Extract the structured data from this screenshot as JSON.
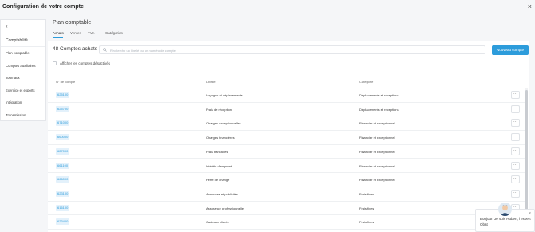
{
  "window": {
    "title": "Configuration de votre compte",
    "close_glyph": "×"
  },
  "sidebar": {
    "back_glyph": "‹",
    "section": "Comptabilité",
    "items": [
      {
        "label": "Plan comptable"
      },
      {
        "label": "Comptes auxiliaires"
      },
      {
        "label": "Journaux"
      },
      {
        "label": "Exercice et exports"
      },
      {
        "label": "Intégration"
      },
      {
        "label": "Transmission"
      }
    ]
  },
  "main": {
    "title": "Plan comptable",
    "tabs": [
      {
        "label": "Achats",
        "active": true
      },
      {
        "label": "Ventes"
      },
      {
        "label": "TVA"
      },
      {
        "label": "Catégories"
      }
    ],
    "count_label": "48 Comptes achats",
    "search": {
      "placeholder": "Recherche un libellé ou un numéro de compte",
      "icon": "search-icon"
    },
    "new_button": "Nouveau compte",
    "show_disabled_label": "Afficher les comptes désactivés",
    "table": {
      "headers": {
        "number": "N° de compte",
        "label": "Libellé",
        "category": "Catégorie"
      },
      "rows": [
        {
          "number": "625100",
          "label": "Voyages et déplacements",
          "category": "Déplacements et réceptions"
        },
        {
          "number": "625700",
          "label": "Frais de réception",
          "category": "Déplacements et réceptions"
        },
        {
          "number": "671000",
          "label": "Charges exceptionnelles",
          "category": "Financier et exceptionnel"
        },
        {
          "number": "660000",
          "label": "Charges financières",
          "category": "Financier et exceptionnel"
        },
        {
          "number": "627000",
          "label": "Frais bancaires",
          "category": "Financier et exceptionnel"
        },
        {
          "number": "661100",
          "label": "Intérêts d'emprunt",
          "category": "Financier et exceptionnel"
        },
        {
          "number": "666000",
          "label": "Perte de change",
          "category": "Financier et exceptionnel"
        },
        {
          "number": "623100",
          "label": "Annonces et publicités",
          "category": "Frais fixes"
        },
        {
          "number": "616100",
          "label": "Assurance professionnelle",
          "category": "Frais fixes"
        },
        {
          "number": "623400",
          "label": "Cadeaux clients",
          "category": "Frais fixes"
        }
      ],
      "row_action_glyph": "···"
    }
  },
  "chat": {
    "message": "Bonjour! Je suis Hubert, l'expert Obat",
    "close_glyph": "×"
  },
  "colors": {
    "accent": "#2d9cdb",
    "background": "#f5f6f8"
  }
}
